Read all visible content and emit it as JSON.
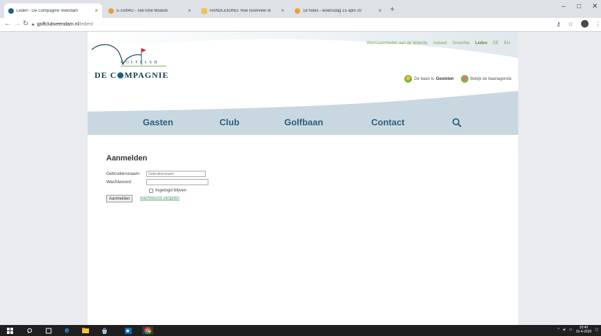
{
  "browser": {
    "tabs": [
      {
        "title": "Leden - De Compagnie Veendam",
        "color": "#1e5f8a",
        "active": true
      },
      {
        "title": "E-Golf4U - TeeTime Module",
        "color": "#e8a03c",
        "active": false
      },
      {
        "title": "HANDLEIDING: Hoe reserveer ik",
        "color": "#f2c14e",
        "active": false
      },
      {
        "title": "18 holes - woensdag 15 april 20",
        "color": "#e8a03c",
        "active": false
      }
    ],
    "new_tab_label": "+",
    "window_controls": {
      "minimize": "–",
      "maximize": "□",
      "close": "✕"
    },
    "url_host": "golfclubveendam.nl",
    "url_path": "/leden/",
    "icons": [
      "back-icon",
      "forward-icon",
      "reload-icon",
      "lock-icon",
      "key-icon",
      "star-icon",
      "profile-icon",
      "menu-icon"
    ]
  },
  "site": {
    "logo": {
      "golfclub_text": "GOLFCLUB",
      "name_before": "DE C",
      "name_after": "MPAGNIE"
    },
    "top_nav": [
      "Werkzaamheden aan de Website",
      "Actueel",
      "Greenfee",
      "Leden",
      "DE",
      "EN"
    ],
    "top_nav_active": "Leden",
    "status": {
      "course_prefix": "De baan is",
      "course_state": "Gesloten",
      "agenda": "Bekijk de baanagenda"
    },
    "main_nav": [
      "Gasten",
      "Club",
      "Golfbaan",
      "Contact"
    ],
    "colors": {
      "nav_text": "#2c5f7d",
      "nav_band": "#c9d8e0",
      "link_green": "#4aa064",
      "flag_red": "#d6282e"
    }
  },
  "login": {
    "title": "Aanmelden",
    "username_label": "Gebruikersnaam",
    "username_placeholder": "Gebruikersnaam",
    "password_label": "Wachtwoord",
    "remember_label": "Ingelogd blijven",
    "submit_label": "Aanmelden",
    "forgot_label": "wachtwoord vergeten"
  },
  "taskbar": {
    "apps": [
      "windows-start-icon",
      "search-icon",
      "task-view-icon",
      "edge-icon",
      "file-explorer-icon",
      "store-icon",
      "outlook-icon",
      "chrome-icon"
    ],
    "time": "10:40",
    "date": "15-4-2020"
  }
}
